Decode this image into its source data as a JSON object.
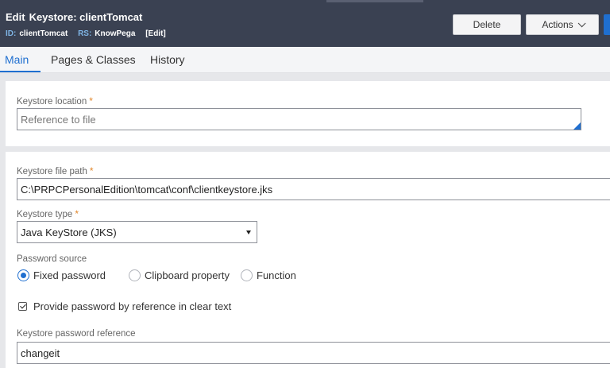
{
  "header": {
    "title_prefix": "Edit",
    "title": "Keystore: clientTomcat",
    "id_label": "ID:",
    "id_value": "clientTomcat",
    "rs_label": "RS:",
    "rs_value": "KnowPega",
    "edit_link": "[Edit]",
    "delete_label": "Delete",
    "actions_label": "Actions"
  },
  "tabs": [
    {
      "label": "Main",
      "active": true
    },
    {
      "label": "Pages & Classes",
      "active": false
    },
    {
      "label": "History",
      "active": false
    }
  ],
  "keystore_location": {
    "label": "Keystore location",
    "required": "*",
    "placeholder": "Reference to file"
  },
  "keystore_file_path": {
    "label": "Keystore file path",
    "required": "*",
    "value": "C:\\PRPCPersonalEdition\\tomcat\\conf\\clientkeystore.jks"
  },
  "keystore_type": {
    "label": "Keystore type",
    "required": "*",
    "value": "Java KeyStore (JKS)"
  },
  "password_source": {
    "label": "Password source",
    "options": [
      "Fixed password",
      "Clipboard property",
      "Function"
    ],
    "selected": "Fixed password"
  },
  "provide_password": {
    "label": "Provide password by reference in clear text",
    "checked": true
  },
  "keystore_password_reference": {
    "label": "Keystore password reference",
    "value": "changeit"
  },
  "colors": {
    "header_bg": "#3a4152",
    "accent": "#1f6fd0",
    "required_star": "#e2862a",
    "meta_label": "#7fb5e6"
  }
}
